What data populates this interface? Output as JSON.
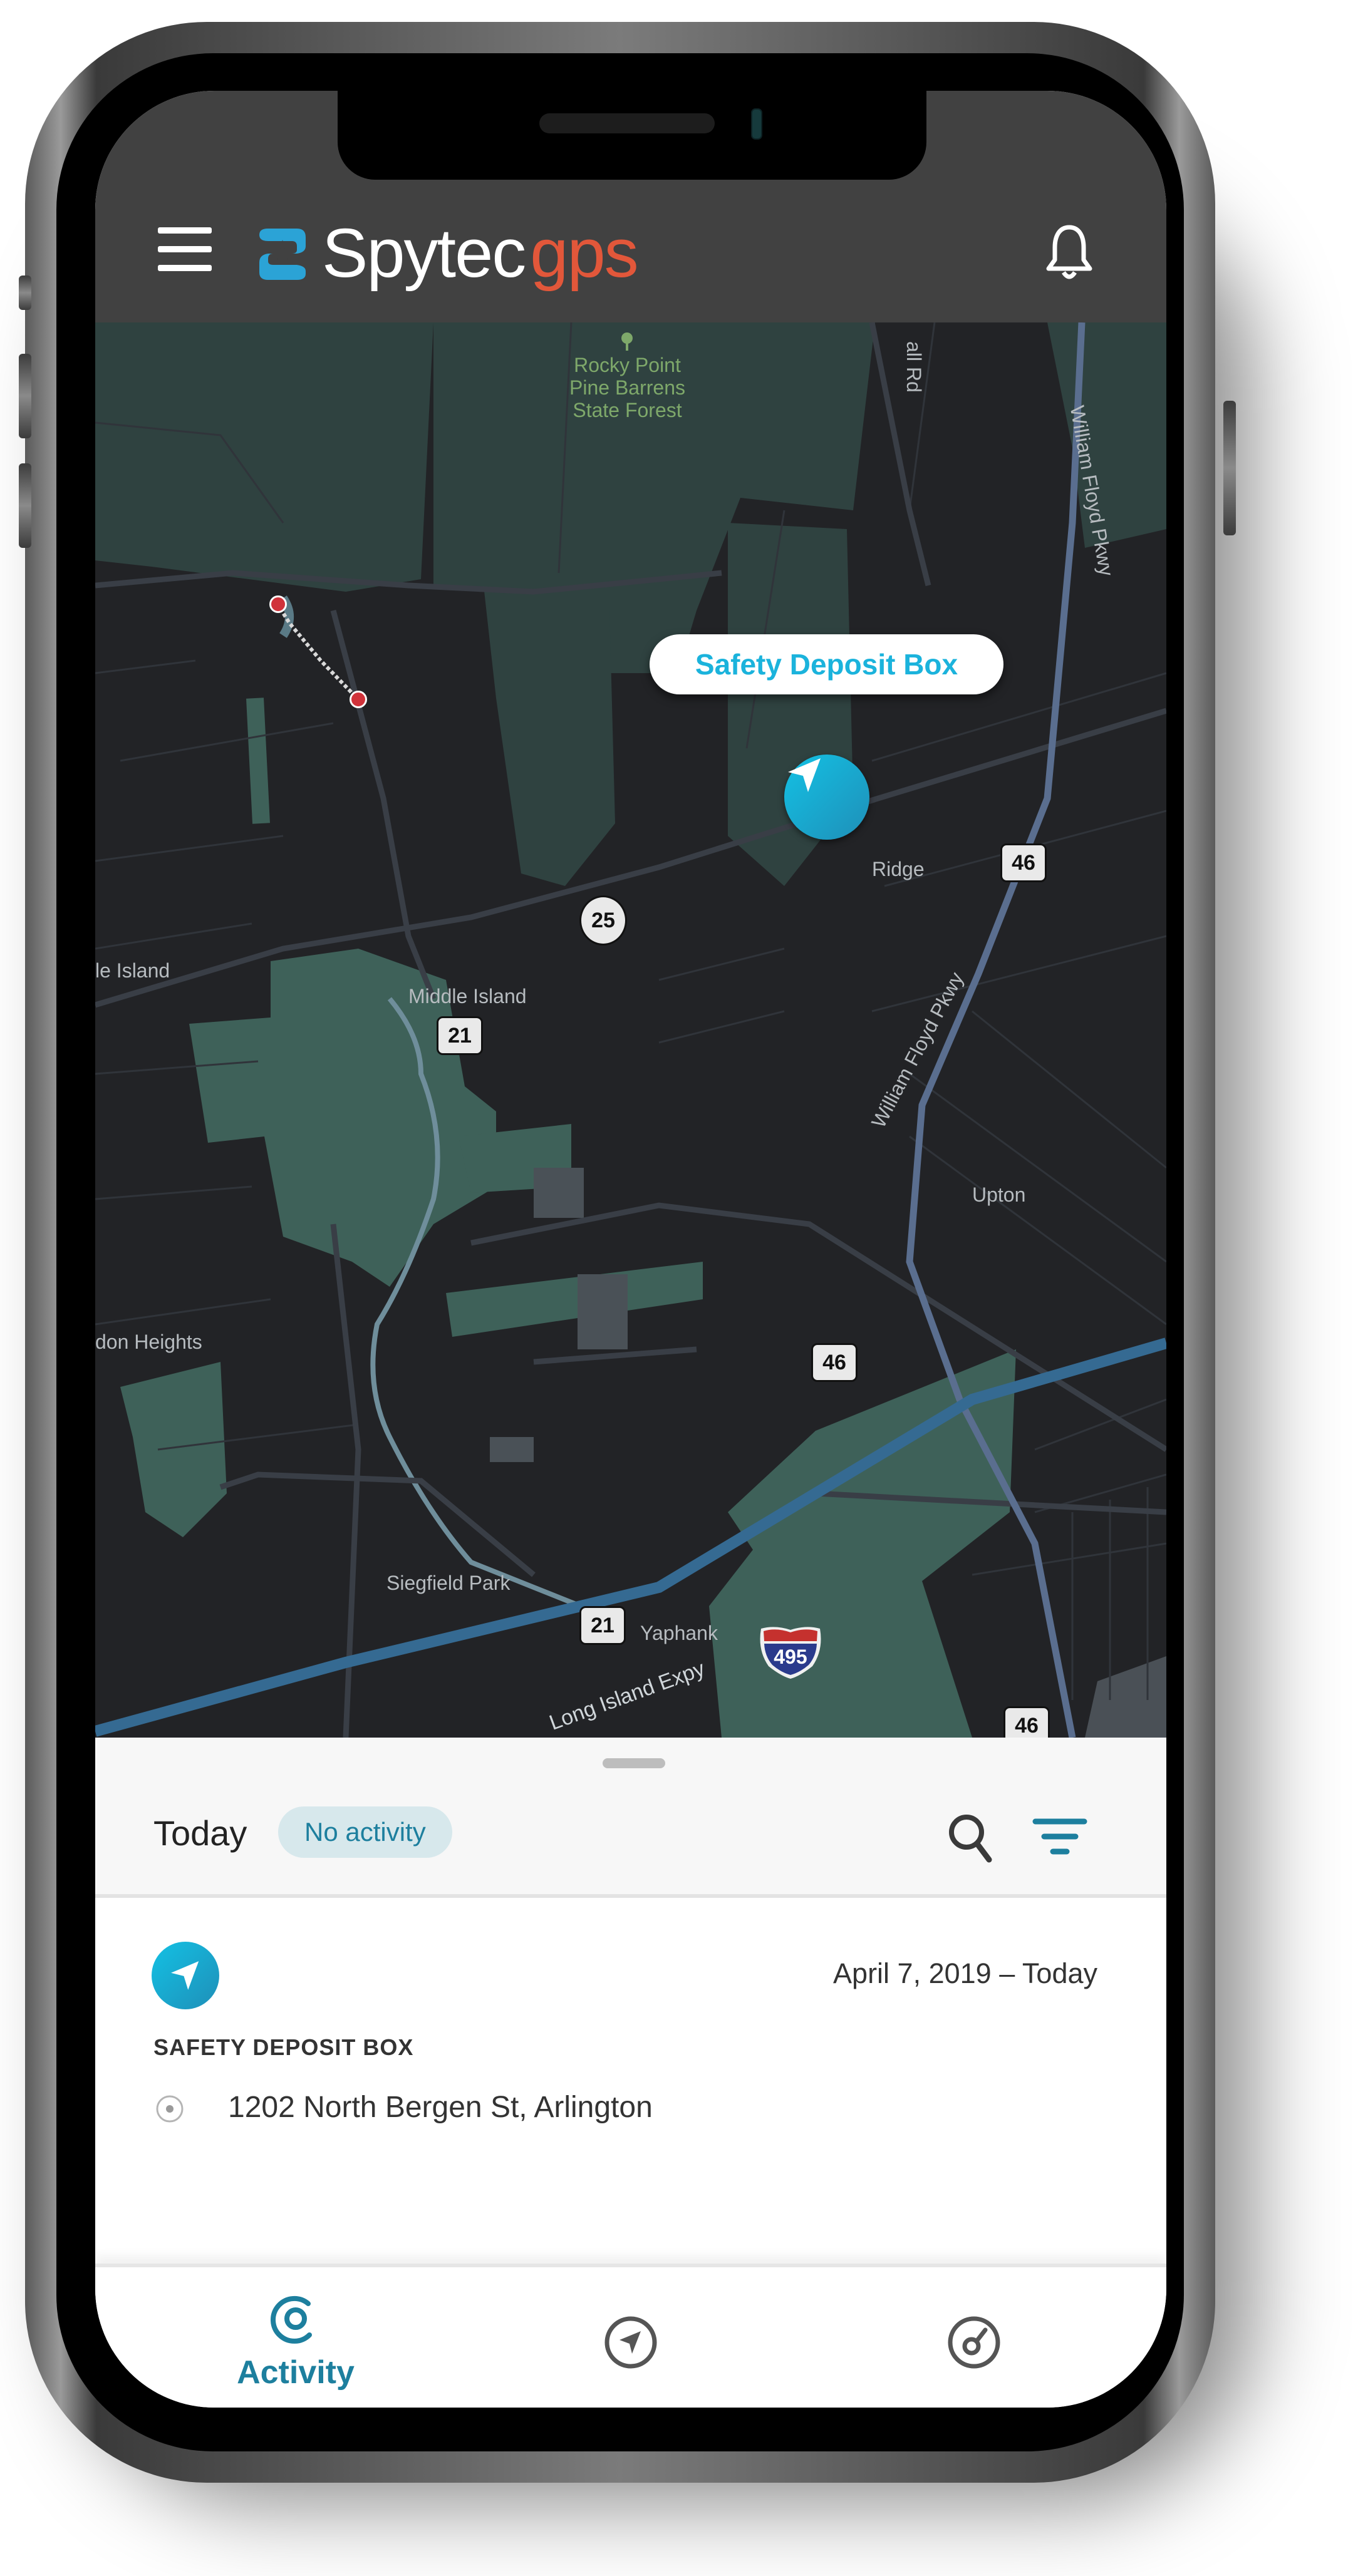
{
  "app": {
    "brand_primary": "Spytec",
    "brand_secondary": "gps",
    "accent_color": "#1d7f9e",
    "marker_color": "#13c1e4",
    "brand_orange": "#e2573a"
  },
  "header": {
    "menu_icon": "hamburger-menu-icon",
    "notification_icon": "bell-icon"
  },
  "map": {
    "callout_label": "Safety Deposit Box",
    "marker_icon": "navigation-arrow-icon",
    "park_label_lines": [
      "Rocky Point",
      "Pine Barrens",
      "State Forest"
    ],
    "labels": {
      "road_top": "all Rd",
      "parkway_north": "William Floyd Pkwy",
      "parkway_south": "William Floyd Pkwy",
      "ridge": "Ridge",
      "middle_island": "Middle Island",
      "left_island": "le Island",
      "upton": "Upton",
      "heights": "don Heights",
      "siegfield": "Siegfield Park",
      "yaphank": "Yaphank",
      "expressway": "Long Island Expy"
    },
    "route_shields": {
      "r46_top": "46",
      "r25": "25",
      "r21_top": "21",
      "r46_mid": "46",
      "r21_bottom": "21",
      "r46_bottom": "46",
      "i495": "495"
    }
  },
  "sheet": {
    "period_label": "Today",
    "status_badge": "No activity",
    "search_icon": "search-icon",
    "filter_icon": "filter-icon"
  },
  "devices": [
    {
      "name": "SAFETY DEPOSIT BOX",
      "date_range": "April 7, 2019 – Today",
      "address": "1202 North Bergen St, Arlington",
      "icon": "navigation-arrow-icon"
    }
  ],
  "bottom_nav": {
    "items": [
      {
        "label": "Activity",
        "icon": "activity-icon",
        "active": true
      },
      {
        "label": "",
        "icon": "locate-icon",
        "active": false
      },
      {
        "label": "",
        "icon": "dashboard-gauge-icon",
        "active": false
      }
    ]
  }
}
